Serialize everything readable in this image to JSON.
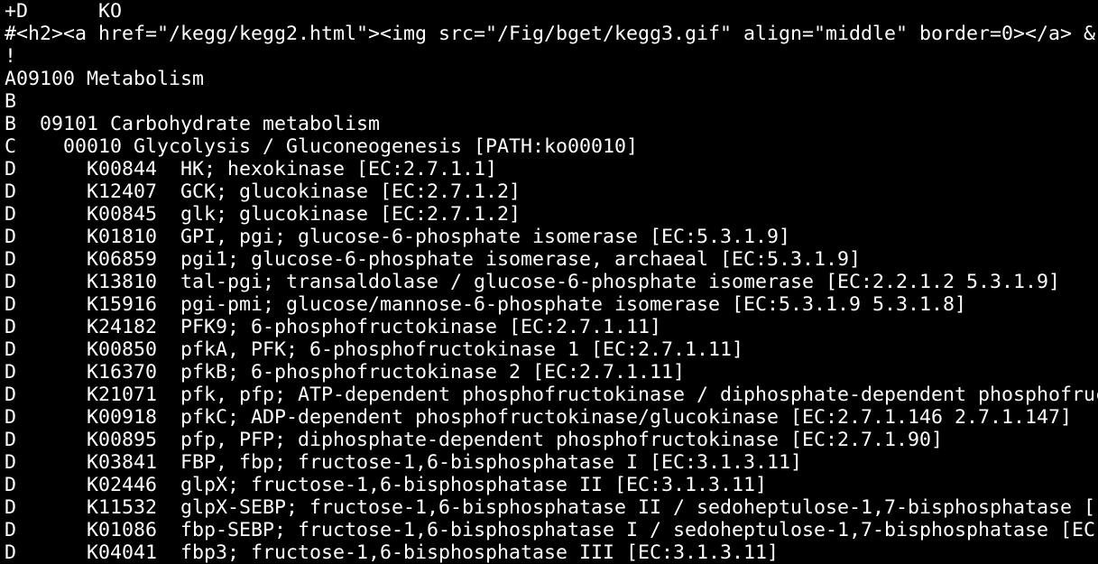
{
  "terminal": {
    "background": "#000000",
    "foreground": "#ffffff",
    "lines": [
      "+D      KO",
      "#<h2><a href=\"/kegg/kegg2.html\"><img src=\"/Fig/bget/kegg3.gif\" align=\"middle\" border=0></a> &",
      "!",
      "A09100 Metabolism",
      "B",
      "B  09101 Carbohydrate metabolism",
      "C    00010 Glycolysis / Gluconeogenesis [PATH:ko00010]",
      "D      K00844  HK; hexokinase [EC:2.7.1.1]",
      "D      K12407  GCK; glucokinase [EC:2.7.1.2]",
      "D      K00845  glk; glucokinase [EC:2.7.1.2]",
      "D      K01810  GPI, pgi; glucose-6-phosphate isomerase [EC:5.3.1.9]",
      "D      K06859  pgi1; glucose-6-phosphate isomerase, archaeal [EC:5.3.1.9]",
      "D      K13810  tal-pgi; transaldolase / glucose-6-phosphate isomerase [EC:2.2.1.2 5.3.1.9]",
      "D      K15916  pgi-pmi; glucose/mannose-6-phosphate isomerase [EC:5.3.1.9 5.3.1.8]",
      "D      K24182  PFK9; 6-phosphofructokinase [EC:2.7.1.11]",
      "D      K00850  pfkA, PFK; 6-phosphofructokinase 1 [EC:2.7.1.11]",
      "D      K16370  pfkB; 6-phosphofructokinase 2 [EC:2.7.1.11]",
      "D      K21071  pfk, pfp; ATP-dependent phosphofructokinase / diphosphate-dependent phosphofruc",
      "D      K00918  pfkC; ADP-dependent phosphofructokinase/glucokinase [EC:2.7.1.146 2.7.1.147]",
      "D      K00895  pfp, PFP; diphosphate-dependent phosphofructokinase [EC:2.7.1.90]",
      "D      K03841  FBP, fbp; fructose-1,6-bisphosphatase I [EC:3.1.3.11]",
      "D      K02446  glpX; fructose-1,6-bisphosphatase II [EC:3.1.3.11]",
      "D      K11532  glpX-SEBP; fructose-1,6-bisphosphatase II / sedoheptulose-1,7-bisphosphatase [",
      "D      K01086  fbp-SEBP; fructose-1,6-bisphosphatase I / sedoheptulose-1,7-bisphosphatase [EC",
      "D      K04041  fbp3; fructose-1,6-bisphosphatase III [EC:3.1.3.11]"
    ]
  }
}
